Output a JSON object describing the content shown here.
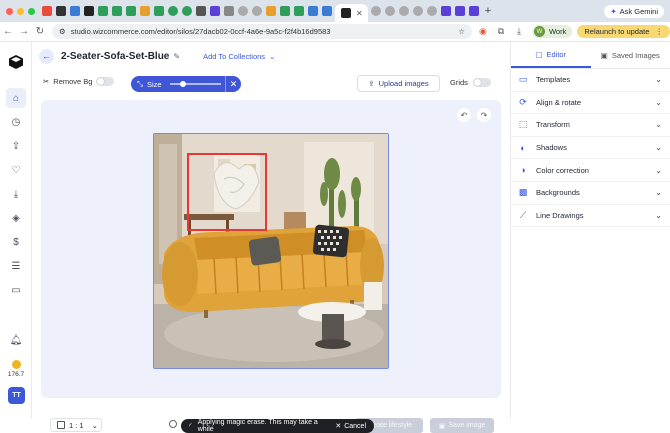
{
  "browser": {
    "active_tab_favicon": "wizcommerce-icon",
    "url": "studio.wizcommerce.com/editor/silos/27dacb02-0ccf-4a6e-9a5c-f2f4b16d9583",
    "ask_gemini": "Ask Gemini",
    "profile_label": "Work",
    "profile_initial": "W",
    "relaunch": "Relaunch to update"
  },
  "app": {
    "title": "2-Seater-Sofa-Set-Blue",
    "add_to_collections": "Add To Collections",
    "toolbar": {
      "remove_bg": "Remove Bg",
      "size": "Size",
      "upload_images": "Upload images",
      "grids": "Grids"
    },
    "bottom": {
      "ratio": "1 : 1",
      "toast": "Applying magic erase. This may take a while",
      "cancel": "Cancel",
      "create_lifestyle": "Create lifestyle",
      "save_image": "Save image"
    },
    "credits": "176.7",
    "user_initials": "TT",
    "right_panel": {
      "tabs": [
        {
          "label": "Editor",
          "icon": "editor-icon"
        },
        {
          "label": "Saved Images",
          "icon": "image-icon"
        }
      ],
      "items": [
        {
          "label": "Templates",
          "icon": "templates-icon"
        },
        {
          "label": "Align & rotate",
          "icon": "align-icon"
        },
        {
          "label": "Transform",
          "icon": "transform-icon"
        },
        {
          "label": "Shadows",
          "icon": "shadows-icon"
        },
        {
          "label": "Color correction",
          "icon": "color-icon"
        },
        {
          "label": "Backgrounds",
          "icon": "backgrounds-icon"
        },
        {
          "label": "Line Drawings",
          "icon": "line-drawings-icon"
        }
      ]
    }
  },
  "colors": {
    "accent": "#3f56d6",
    "sofa": "#e0a33a",
    "selection": "#e53935",
    "canvas_bg": "#eef1fb"
  }
}
